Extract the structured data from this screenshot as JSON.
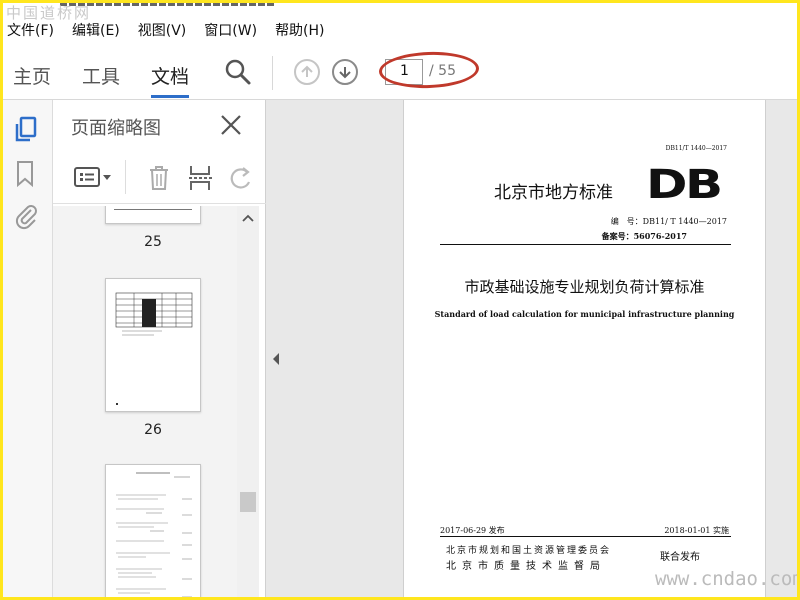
{
  "watermarks": {
    "top": "中国道桥网",
    "bottom": "www.cndao.com"
  },
  "menu": [
    "文件(F)",
    "编辑(E)",
    "视图(V)",
    "窗口(W)",
    "帮助(H)"
  ],
  "toolbar": {
    "tabs": [
      "主页",
      "工具",
      "文档"
    ],
    "active_tab": "文档",
    "page_current": "1",
    "page_total": "/ 55",
    "accent_color": "#2d6ec9"
  },
  "sidebar": {
    "rail_icons": [
      "pages-icon",
      "bookmark-icon",
      "attachment-icon"
    ],
    "pane_title": "页面缩略图",
    "thumbnails": [
      {
        "label": "25"
      },
      {
        "label": "26"
      },
      {
        "label": ""
      }
    ]
  },
  "document": {
    "code": "DB11/T 1440—2017",
    "standard_type": "北京市地方标准",
    "logo": "DB",
    "number": "编　号：DB11/ T 1440—2017",
    "filing": "备案号：56076-2017",
    "title_cn": "市政基础设施专业规划负荷计算标准",
    "title_en": "Standard of load calculation for municipal infrastructure planning",
    "issue_date": "2017-06-29 发布",
    "implement_date": "2018-01-01 实施",
    "issuer_1": "北京市规划和国土资源管理委员会",
    "issuer_2": "北京市质量技术监督局",
    "joint": "联合发布"
  }
}
